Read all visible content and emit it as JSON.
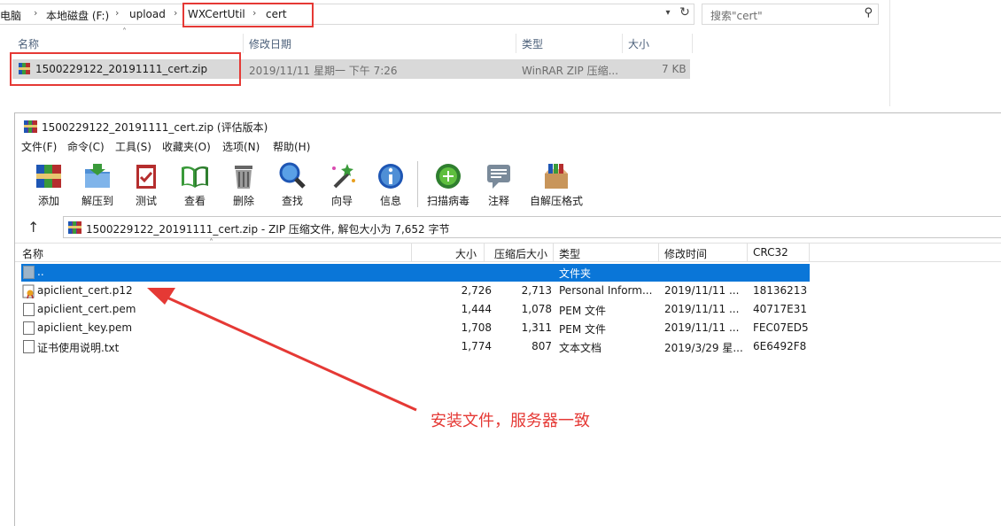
{
  "explorer": {
    "breadcrumb": [
      "电脑",
      "本地磁盘 (F:)",
      "upload",
      "WXCertUtil",
      "cert"
    ],
    "search_placeholder": "搜索\"cert\"",
    "columns": {
      "name": "名称",
      "modified": "修改日期",
      "type": "类型",
      "size": "大小"
    },
    "file": {
      "name": "1500229122_20191111_cert.zip",
      "modified": "2019/11/11 星期一 下午 7:26",
      "type": "WinRAR ZIP 压缩...",
      "size": "7 KB"
    }
  },
  "rar": {
    "title": "1500229122_20191111_cert.zip (评估版本)",
    "menu": [
      "文件(F)",
      "命令(C)",
      "工具(S)",
      "收藏夹(O)",
      "选项(N)",
      "帮助(H)"
    ],
    "toolbar": [
      "添加",
      "解压到",
      "测试",
      "查看",
      "删除",
      "查找",
      "向导",
      "信息",
      "扫描病毒",
      "注释",
      "自解压格式"
    ],
    "path_text": "1500229122_20191111_cert.zip - ZIP 压缩文件, 解包大小为 7,652 字节",
    "columns": {
      "name": "名称",
      "size": "大小",
      "packed": "压缩后大小",
      "type": "类型",
      "modified": "修改时间",
      "crc": "CRC32"
    },
    "rows": [
      {
        "name": "..",
        "size": "",
        "packed": "",
        "type": "文件夹",
        "modified": "",
        "crc": ""
      },
      {
        "name": "apiclient_cert.p12",
        "size": "2,726",
        "packed": "2,713",
        "type": "Personal Inform...",
        "modified": "2019/11/11 ...",
        "crc": "18136213"
      },
      {
        "name": "apiclient_cert.pem",
        "size": "1,444",
        "packed": "1,078",
        "type": "PEM 文件",
        "modified": "2019/11/11 ...",
        "crc": "40717E31"
      },
      {
        "name": "apiclient_key.pem",
        "size": "1,708",
        "packed": "1,311",
        "type": "PEM 文件",
        "modified": "2019/11/11 ...",
        "crc": "FEC07ED5"
      },
      {
        "name": "证书使用说明.txt",
        "size": "1,774",
        "packed": "807",
        "type": "文本文档",
        "modified": "2019/3/29 星...",
        "crc": "6E6492F8"
      }
    ]
  },
  "annotation": {
    "text": "安装文件，服务器一致",
    "color": "#e53935"
  },
  "colors": {
    "selection": "#0a76d8",
    "highlight_row": "#d9d9d9",
    "annotation": "#e53935"
  }
}
